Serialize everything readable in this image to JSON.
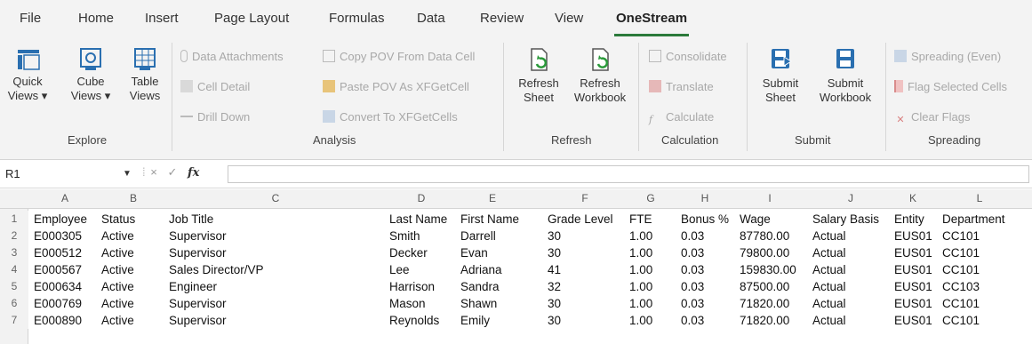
{
  "ribbon_tabs": [
    "File",
    "Home",
    "Insert",
    "Page Layout",
    "Formulas",
    "Data",
    "Review",
    "View",
    "OneStream"
  ],
  "active_tab": "OneStream",
  "explore": {
    "label": "Explore",
    "quick": "Quick\nViews ▾",
    "cube": "Cube\nViews ▾",
    "table": "Table\nViews"
  },
  "analysis": {
    "label": "Analysis",
    "items": [
      "Data Attachments",
      "Cell Detail",
      "Drill Down",
      "Copy POV From Data Cell",
      "Paste POV As XFGetCell",
      "Convert To XFGetCells"
    ]
  },
  "refresh": {
    "label": "Refresh",
    "sheet": "Refresh\nSheet",
    "workbook": "Refresh\nWorkbook"
  },
  "calculation": {
    "label": "Calculation",
    "items": [
      "Consolidate",
      "Translate",
      "Calculate"
    ]
  },
  "submit": {
    "label": "Submit",
    "sheet": "Submit\nSheet",
    "workbook": "Submit\nWorkbook"
  },
  "spreading": {
    "label": "Spreading",
    "items": [
      "Spreading (Even)",
      "Flag Selected Cells",
      "Clear Flags"
    ]
  },
  "formula_bar": {
    "name_box": "R1",
    "cancel": "×",
    "enter": "✓",
    "fx": "fx",
    "content": ""
  },
  "columns": [
    "A",
    "B",
    "C",
    "D",
    "E",
    "F",
    "G",
    "H",
    "I",
    "J",
    "K",
    "L"
  ],
  "headers": [
    "Employee",
    "Status",
    "Job Title",
    "Last Name",
    "First Name",
    "Grade Level",
    "FTE",
    "Bonus %",
    "Wage",
    "Salary Basis",
    "Entity",
    "Department"
  ],
  "rows": [
    [
      "E000305",
      "Active",
      "Supervisor",
      "Smith",
      "Darrell",
      "30",
      "1.00",
      "0.03",
      "87780.00",
      "Actual",
      "EUS01",
      "CC101"
    ],
    [
      "E000512",
      "Active",
      "Supervisor",
      "Decker",
      "Evan",
      "30",
      "1.00",
      "0.03",
      "79800.00",
      "Actual",
      "EUS01",
      "CC101"
    ],
    [
      "E000567",
      "Active",
      "Sales Director/VP",
      "Lee",
      "Adriana",
      "41",
      "1.00",
      "0.03",
      "159830.00",
      "Actual",
      "EUS01",
      "CC101"
    ],
    [
      "E000634",
      "Active",
      "Engineer",
      "Harrison",
      "Sandra",
      "32",
      "1.00",
      "0.03",
      "87500.00",
      "Actual",
      "EUS01",
      "CC103"
    ],
    [
      "E000769",
      "Active",
      "Supervisor",
      "Mason",
      "Shawn",
      "30",
      "1.00",
      "0.03",
      "71820.00",
      "Actual",
      "EUS01",
      "CC101"
    ],
    [
      "E000890",
      "Active",
      "Supervisor",
      "Reynolds",
      "Emily",
      "30",
      "1.00",
      "0.03",
      "71820.00",
      "Actual",
      "EUS01",
      "CC101"
    ]
  ],
  "row_numbers": [
    "1",
    "2",
    "3",
    "4",
    "5",
    "6",
    "7"
  ],
  "colors": {
    "accent": "#2b7a3b",
    "ribbon_bg": "#f3f3f3",
    "disabled_text": "#a8a8a8"
  }
}
